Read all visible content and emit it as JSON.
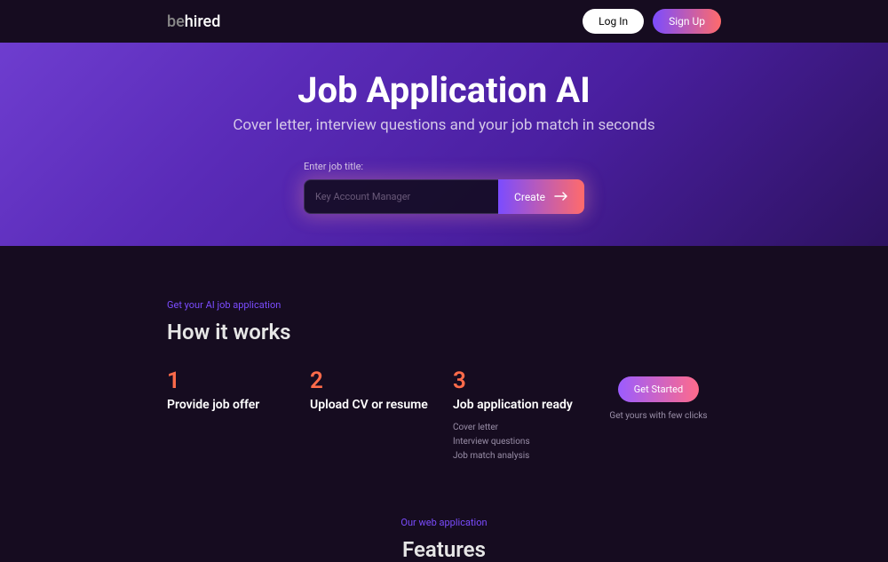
{
  "header": {
    "logo_prefix": "be",
    "logo_suffix": "hired",
    "login_label": "Log In",
    "signup_label": "Sign Up"
  },
  "hero": {
    "title": "Job Application AI",
    "subtitle": "Cover letter, interview questions and your job match in seconds",
    "input_label": "Enter job title:",
    "input_placeholder": "Key Account Manager",
    "create_label": "Create"
  },
  "how": {
    "eyebrow": "Get your AI job application",
    "title": "How it works",
    "steps": [
      {
        "num": "1",
        "title": "Provide job offer",
        "items": []
      },
      {
        "num": "2",
        "title": "Upload CV or resume",
        "items": []
      },
      {
        "num": "3",
        "title": "Job application ready",
        "items": [
          "Cover letter",
          "Interview questions",
          "Job match analysis"
        ]
      }
    ],
    "cta_label": "Get Started",
    "cta_sub": "Get yours with few clicks"
  },
  "features": {
    "eyebrow": "Our web application",
    "title": "Features"
  }
}
